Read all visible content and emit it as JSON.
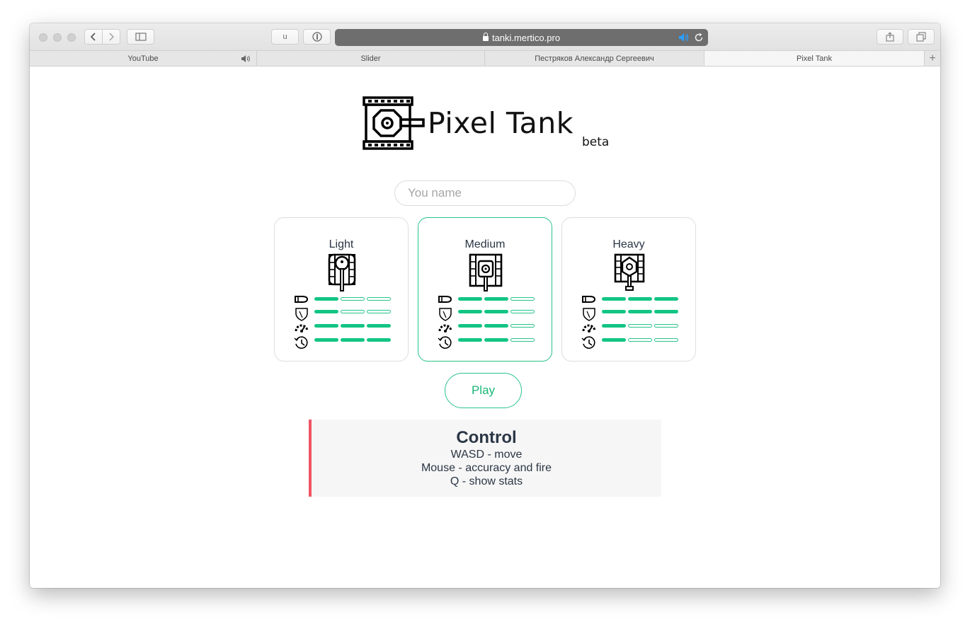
{
  "browser": {
    "url": "tanki.mertico.pro",
    "reader_button_label": "u",
    "tabs": [
      {
        "label": "YouTube",
        "audio": true
      },
      {
        "label": "Slider",
        "audio": false
      },
      {
        "label": "Пестряков Александр Сергеевич",
        "audio": false
      },
      {
        "label": "Pixel Tank",
        "audio": false,
        "active": true
      }
    ],
    "new_tab_label": "+"
  },
  "page": {
    "logo_title": "Pixel Tank",
    "logo_badge": "beta",
    "name_placeholder": "You name",
    "name_value": "",
    "tanks": [
      {
        "name": "Light",
        "selected": false,
        "stats": {
          "damage": 1,
          "armor": 1,
          "speed": 3,
          "reload": 3
        },
        "max": 3
      },
      {
        "name": "Medium",
        "selected": true,
        "stats": {
          "damage": 2,
          "armor": 2,
          "speed": 2,
          "reload": 2
        },
        "max": 3
      },
      {
        "name": "Heavy",
        "selected": false,
        "stats": {
          "damage": 3,
          "armor": 3,
          "speed": 1,
          "reload": 1
        },
        "max": 3
      }
    ],
    "stat_icons": [
      "bullet-icon",
      "shield-icon",
      "speedometer-icon",
      "clock-icon"
    ],
    "play_label": "Play",
    "control": {
      "title": "Control",
      "lines": [
        "WASD - move",
        "Mouse - accuracy and fire",
        "Q - show stats"
      ]
    },
    "colors": {
      "accent": "#12c584",
      "control_border": "#f05564",
      "text": "#2b3645"
    }
  }
}
